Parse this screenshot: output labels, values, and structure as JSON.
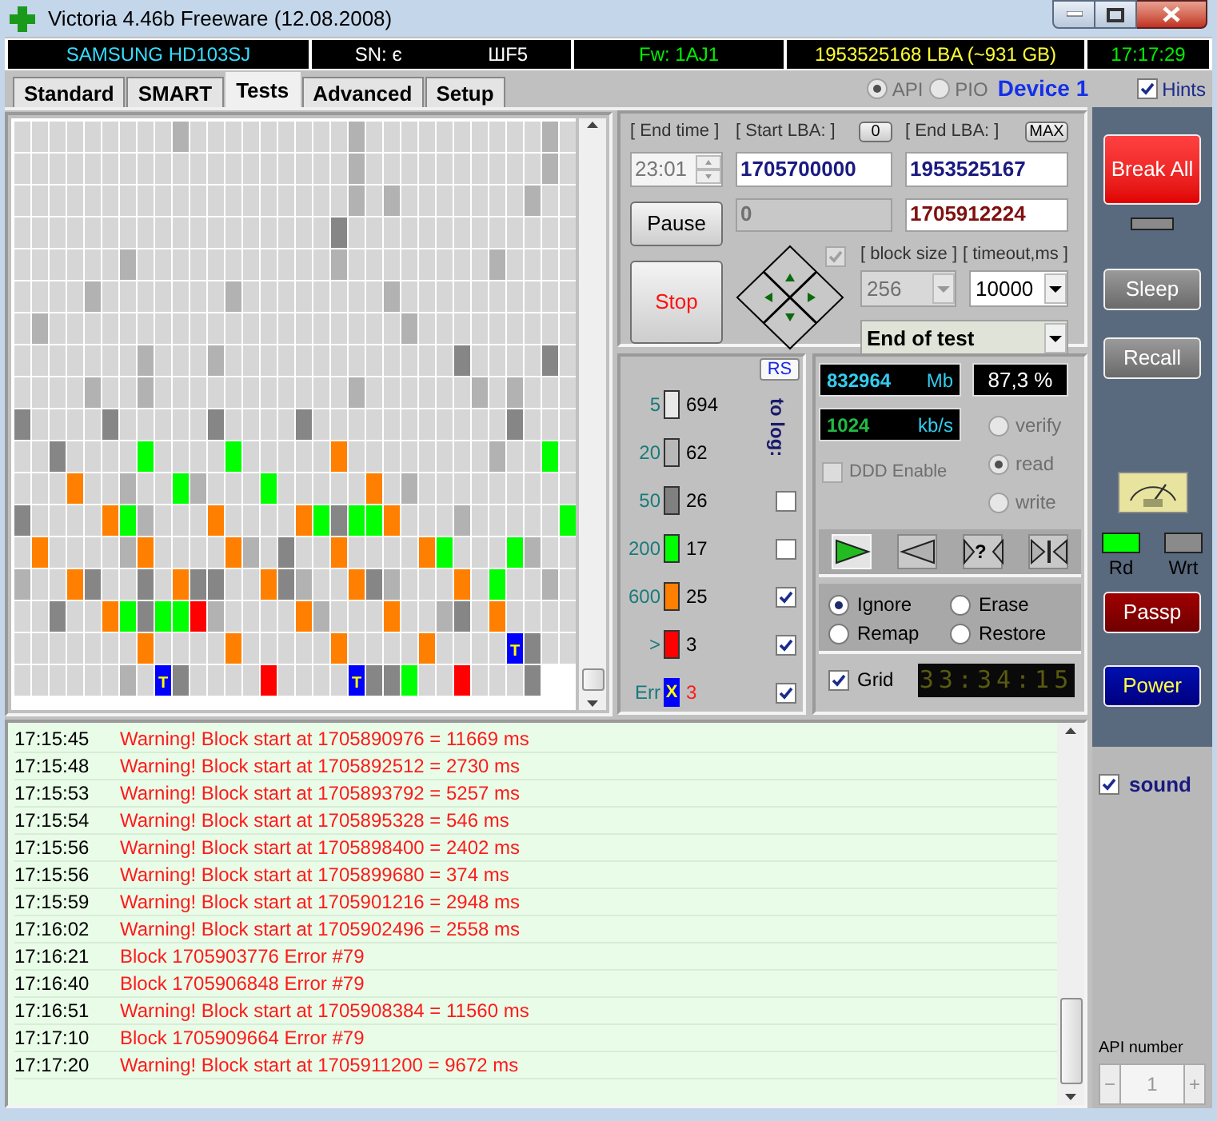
{
  "window": {
    "title": "Victoria 4.46b Freeware (12.08.2008)"
  },
  "info_bar": [
    {
      "texts": [
        "SAMSUNG HD103SJ"
      ],
      "kind": "model"
    },
    {
      "texts": [
        "SN: є",
        "ШF5"
      ],
      "kind": "serial"
    },
    {
      "texts": [
        "Fw: 1AJ1"
      ],
      "kind": "firmware"
    },
    {
      "texts": [
        "1953525168 LBA (~931 GB)"
      ],
      "kind": "capacity"
    },
    {
      "texts": [
        "17:17:29"
      ],
      "kind": "clock"
    }
  ],
  "tabs": [
    {
      "label": "Standard",
      "selected": false
    },
    {
      "label": "SMART",
      "selected": false
    },
    {
      "label": "Tests",
      "selected": true
    },
    {
      "label": "Advanced",
      "selected": false
    },
    {
      "label": "Setup",
      "selected": false
    }
  ],
  "interface": {
    "options": [
      {
        "label": "API",
        "selected": true,
        "disabled": true
      },
      {
        "label": "PIO",
        "selected": false,
        "disabled": true
      }
    ],
    "device": "Device 1"
  },
  "hints": {
    "label": "Hints",
    "checked": true
  },
  "grid": {
    "rows": [
      [
        {
          "color": "#d6d6d6"
        },
        {
          "color": "#d6d6d6"
        },
        {
          "color": "#d6d6d6"
        },
        {
          "color": "#d6d6d6"
        },
        {
          "color": "#d6d6d6"
        },
        {
          "color": "#d6d6d6"
        },
        {
          "color": "#d6d6d6"
        },
        {
          "color": "#d6d6d6"
        },
        {
          "color": "#d6d6d6"
        },
        {
          "color": "#b2b2b2"
        },
        {
          "color": "#d6d6d6"
        },
        {
          "color": "#d6d6d6"
        },
        {
          "color": "#d6d6d6"
        },
        {
          "color": "#d6d6d6"
        },
        {
          "color": "#d6d6d6"
        },
        {
          "color": "#d6d6d6"
        },
        {
          "color": "#d6d6d6"
        },
        {
          "color": "#d6d6d6"
        },
        {
          "color": "#d6d6d6"
        },
        {
          "color": "#b2b2b2"
        },
        {
          "color": "#d6d6d6"
        },
        {
          "color": "#d6d6d6"
        },
        {
          "color": "#d6d6d6"
        },
        {
          "color": "#d6d6d6"
        },
        {
          "color": "#d6d6d6"
        },
        {
          "color": "#d6d6d6"
        },
        {
          "color": "#d6d6d6"
        },
        {
          "color": "#d6d6d6"
        },
        {
          "color": "#d6d6d6"
        },
        {
          "color": "#d6d6d6"
        },
        {
          "color": "#b2b2b2"
        },
        {
          "color": "#d6d6d6"
        }
      ],
      [
        {
          "color": "#d6d6d6"
        },
        {
          "color": "#d6d6d6"
        },
        {
          "color": "#d6d6d6"
        },
        {
          "color": "#d6d6d6"
        },
        {
          "color": "#d6d6d6"
        },
        {
          "color": "#d6d6d6"
        },
        {
          "color": "#d6d6d6"
        },
        {
          "color": "#d6d6d6"
        },
        {
          "color": "#d6d6d6"
        },
        {
          "color": "#d6d6d6"
        },
        {
          "color": "#d6d6d6"
        },
        {
          "color": "#d6d6d6"
        },
        {
          "color": "#d6d6d6"
        },
        {
          "color": "#d6d6d6"
        },
        {
          "color": "#d6d6d6"
        },
        {
          "color": "#d6d6d6"
        },
        {
          "color": "#d6d6d6"
        },
        {
          "color": "#d6d6d6"
        },
        {
          "color": "#d6d6d6"
        },
        {
          "color": "#b2b2b2"
        },
        {
          "color": "#d6d6d6"
        },
        {
          "color": "#d6d6d6"
        },
        {
          "color": "#d6d6d6"
        },
        {
          "color": "#d6d6d6"
        },
        {
          "color": "#d6d6d6"
        },
        {
          "color": "#d6d6d6"
        },
        {
          "color": "#d6d6d6"
        },
        {
          "color": "#d6d6d6"
        },
        {
          "color": "#d6d6d6"
        },
        {
          "color": "#d6d6d6"
        },
        {
          "color": "#b2b2b2"
        },
        {
          "color": "#d6d6d6"
        }
      ],
      [
        {
          "color": "#d6d6d6"
        },
        {
          "color": "#d6d6d6"
        },
        {
          "color": "#d6d6d6"
        },
        {
          "color": "#d6d6d6"
        },
        {
          "color": "#d6d6d6"
        },
        {
          "color": "#d6d6d6"
        },
        {
          "color": "#d6d6d6"
        },
        {
          "color": "#d6d6d6"
        },
        {
          "color": "#d6d6d6"
        },
        {
          "color": "#d6d6d6"
        },
        {
          "color": "#d6d6d6"
        },
        {
          "color": "#d6d6d6"
        },
        {
          "color": "#d6d6d6"
        },
        {
          "color": "#d6d6d6"
        },
        {
          "color": "#d6d6d6"
        },
        {
          "color": "#d6d6d6"
        },
        {
          "color": "#d6d6d6"
        },
        {
          "color": "#d6d6d6"
        },
        {
          "color": "#d6d6d6"
        },
        {
          "color": "#b2b2b2"
        },
        {
          "color": "#d6d6d6"
        },
        {
          "color": "#b2b2b2"
        },
        {
          "color": "#d6d6d6"
        },
        {
          "color": "#d6d6d6"
        },
        {
          "color": "#d6d6d6"
        },
        {
          "color": "#d6d6d6"
        },
        {
          "color": "#d6d6d6"
        },
        {
          "color": "#d6d6d6"
        },
        {
          "color": "#d6d6d6"
        },
        {
          "color": "#b2b2b2"
        },
        {
          "color": "#d6d6d6"
        },
        {
          "color": "#d6d6d6"
        }
      ],
      [
        {
          "color": "#d6d6d6"
        },
        {
          "color": "#d6d6d6"
        },
        {
          "color": "#d6d6d6"
        },
        {
          "color": "#d6d6d6"
        },
        {
          "color": "#d6d6d6"
        },
        {
          "color": "#d6d6d6"
        },
        {
          "color": "#d6d6d6"
        },
        {
          "color": "#d6d6d6"
        },
        {
          "color": "#d6d6d6"
        },
        {
          "color": "#d6d6d6"
        },
        {
          "color": "#d6d6d6"
        },
        {
          "color": "#d6d6d6"
        },
        {
          "color": "#d6d6d6"
        },
        {
          "color": "#d6d6d6"
        },
        {
          "color": "#d6d6d6"
        },
        {
          "color": "#d6d6d6"
        },
        {
          "color": "#d6d6d6"
        },
        {
          "color": "#d6d6d6"
        },
        {
          "color": "#868686"
        },
        {
          "color": "#d6d6d6"
        },
        {
          "color": "#d6d6d6"
        },
        {
          "color": "#d6d6d6"
        },
        {
          "color": "#d6d6d6"
        },
        {
          "color": "#d6d6d6"
        },
        {
          "color": "#d6d6d6"
        },
        {
          "color": "#d6d6d6"
        },
        {
          "color": "#d6d6d6"
        },
        {
          "color": "#d6d6d6"
        },
        {
          "color": "#d6d6d6"
        },
        {
          "color": "#d6d6d6"
        },
        {
          "color": "#d6d6d6"
        },
        {
          "color": "#d6d6d6"
        }
      ],
      [
        {
          "color": "#d6d6d6"
        },
        {
          "color": "#d6d6d6"
        },
        {
          "color": "#d6d6d6"
        },
        {
          "color": "#d6d6d6"
        },
        {
          "color": "#d6d6d6"
        },
        {
          "color": "#d6d6d6"
        },
        {
          "color": "#b2b2b2"
        },
        {
          "color": "#d6d6d6"
        },
        {
          "color": "#d6d6d6"
        },
        {
          "color": "#d6d6d6"
        },
        {
          "color": "#d6d6d6"
        },
        {
          "color": "#d6d6d6"
        },
        {
          "color": "#d6d6d6"
        },
        {
          "color": "#d6d6d6"
        },
        {
          "color": "#d6d6d6"
        },
        {
          "color": "#d6d6d6"
        },
        {
          "color": "#d6d6d6"
        },
        {
          "color": "#d6d6d6"
        },
        {
          "color": "#b2b2b2"
        },
        {
          "color": "#d6d6d6"
        },
        {
          "color": "#d6d6d6"
        },
        {
          "color": "#d6d6d6"
        },
        {
          "color": "#d6d6d6"
        },
        {
          "color": "#d6d6d6"
        },
        {
          "color": "#d6d6d6"
        },
        {
          "color": "#d6d6d6"
        },
        {
          "color": "#d6d6d6"
        },
        {
          "color": "#b2b2b2"
        },
        {
          "color": "#d6d6d6"
        },
        {
          "color": "#d6d6d6"
        },
        {
          "color": "#d6d6d6"
        },
        {
          "color": "#d6d6d6"
        }
      ],
      [
        {
          "color": "#d6d6d6"
        },
        {
          "color": "#d6d6d6"
        },
        {
          "color": "#d6d6d6"
        },
        {
          "color": "#d6d6d6"
        },
        {
          "color": "#b2b2b2"
        },
        {
          "color": "#d6d6d6"
        },
        {
          "color": "#d6d6d6"
        },
        {
          "color": "#d6d6d6"
        },
        {
          "color": "#d6d6d6"
        },
        {
          "color": "#d6d6d6"
        },
        {
          "color": "#d6d6d6"
        },
        {
          "color": "#d6d6d6"
        },
        {
          "color": "#b2b2b2"
        },
        {
          "color": "#d6d6d6"
        },
        {
          "color": "#d6d6d6"
        },
        {
          "color": "#d6d6d6"
        },
        {
          "color": "#d6d6d6"
        },
        {
          "color": "#d6d6d6"
        },
        {
          "color": "#d6d6d6"
        },
        {
          "color": "#d6d6d6"
        },
        {
          "color": "#d6d6d6"
        },
        {
          "color": "#b2b2b2"
        },
        {
          "color": "#d6d6d6"
        },
        {
          "color": "#d6d6d6"
        },
        {
          "color": "#d6d6d6"
        },
        {
          "color": "#d6d6d6"
        },
        {
          "color": "#d6d6d6"
        },
        {
          "color": "#d6d6d6"
        },
        {
          "color": "#d6d6d6"
        },
        {
          "color": "#d6d6d6"
        },
        {
          "color": "#d6d6d6"
        },
        {
          "color": "#d6d6d6"
        }
      ],
      [
        {
          "color": "#d6d6d6"
        },
        {
          "color": "#b2b2b2"
        },
        {
          "color": "#d6d6d6"
        },
        {
          "color": "#d6d6d6"
        },
        {
          "color": "#d6d6d6"
        },
        {
          "color": "#d6d6d6"
        },
        {
          "color": "#d6d6d6"
        },
        {
          "color": "#d6d6d6"
        },
        {
          "color": "#d6d6d6"
        },
        {
          "color": "#d6d6d6"
        },
        {
          "color": "#d6d6d6"
        },
        {
          "color": "#d6d6d6"
        },
        {
          "color": "#d6d6d6"
        },
        {
          "color": "#d6d6d6"
        },
        {
          "color": "#d6d6d6"
        },
        {
          "color": "#d6d6d6"
        },
        {
          "color": "#d6d6d6"
        },
        {
          "color": "#d6d6d6"
        },
        {
          "color": "#d6d6d6"
        },
        {
          "color": "#d6d6d6"
        },
        {
          "color": "#d6d6d6"
        },
        {
          "color": "#d6d6d6"
        },
        {
          "color": "#b2b2b2"
        },
        {
          "color": "#d6d6d6"
        },
        {
          "color": "#d6d6d6"
        },
        {
          "color": "#d6d6d6"
        },
        {
          "color": "#d6d6d6"
        },
        {
          "color": "#d6d6d6"
        },
        {
          "color": "#d6d6d6"
        },
        {
          "color": "#d6d6d6"
        },
        {
          "color": "#d6d6d6"
        },
        {
          "color": "#d6d6d6"
        }
      ],
      [
        {
          "color": "#d6d6d6"
        },
        {
          "color": "#d6d6d6"
        },
        {
          "color": "#d6d6d6"
        },
        {
          "color": "#d6d6d6"
        },
        {
          "color": "#d6d6d6"
        },
        {
          "color": "#d6d6d6"
        },
        {
          "color": "#d6d6d6"
        },
        {
          "color": "#b2b2b2"
        },
        {
          "color": "#d6d6d6"
        },
        {
          "color": "#d6d6d6"
        },
        {
          "color": "#d6d6d6"
        },
        {
          "color": "#b2b2b2"
        },
        {
          "color": "#d6d6d6"
        },
        {
          "color": "#d6d6d6"
        },
        {
          "color": "#d6d6d6"
        },
        {
          "color": "#d6d6d6"
        },
        {
          "color": "#d6d6d6"
        },
        {
          "color": "#d6d6d6"
        },
        {
          "color": "#d6d6d6"
        },
        {
          "color": "#d6d6d6"
        },
        {
          "color": "#d6d6d6"
        },
        {
          "color": "#d6d6d6"
        },
        {
          "color": "#d6d6d6"
        },
        {
          "color": "#d6d6d6"
        },
        {
          "color": "#d6d6d6"
        },
        {
          "color": "#868686"
        },
        {
          "color": "#d6d6d6"
        },
        {
          "color": "#d6d6d6"
        },
        {
          "color": "#d6d6d6"
        },
        {
          "color": "#d6d6d6"
        },
        {
          "color": "#868686"
        },
        {
          "color": "#d6d6d6"
        }
      ],
      [
        {
          "color": "#d6d6d6"
        },
        {
          "color": "#d6d6d6"
        },
        {
          "color": "#d6d6d6"
        },
        {
          "color": "#d6d6d6"
        },
        {
          "color": "#b2b2b2"
        },
        {
          "color": "#d6d6d6"
        },
        {
          "color": "#d6d6d6"
        },
        {
          "color": "#b2b2b2"
        },
        {
          "color": "#d6d6d6"
        },
        {
          "color": "#d6d6d6"
        },
        {
          "color": "#d6d6d6"
        },
        {
          "color": "#d6d6d6"
        },
        {
          "color": "#d6d6d6"
        },
        {
          "color": "#d6d6d6"
        },
        {
          "color": "#d6d6d6"
        },
        {
          "color": "#d6d6d6"
        },
        {
          "color": "#d6d6d6"
        },
        {
          "color": "#d6d6d6"
        },
        {
          "color": "#d6d6d6"
        },
        {
          "color": "#b2b2b2"
        },
        {
          "color": "#d6d6d6"
        },
        {
          "color": "#d6d6d6"
        },
        {
          "color": "#d6d6d6"
        },
        {
          "color": "#d6d6d6"
        },
        {
          "color": "#d6d6d6"
        },
        {
          "color": "#d6d6d6"
        },
        {
          "color": "#b2b2b2"
        },
        {
          "color": "#d6d6d6"
        },
        {
          "color": "#b2b2b2"
        },
        {
          "color": "#d6d6d6"
        },
        {
          "color": "#d6d6d6"
        },
        {
          "color": "#d6d6d6"
        }
      ],
      [
        {
          "color": "#868686"
        },
        {
          "color": "#d6d6d6"
        },
        {
          "color": "#d6d6d6"
        },
        {
          "color": "#d6d6d6"
        },
        {
          "color": "#d6d6d6"
        },
        {
          "color": "#868686"
        },
        {
          "color": "#d6d6d6"
        },
        {
          "color": "#d6d6d6"
        },
        {
          "color": "#d6d6d6"
        },
        {
          "color": "#d6d6d6"
        },
        {
          "color": "#d6d6d6"
        },
        {
          "color": "#868686"
        },
        {
          "color": "#d6d6d6"
        },
        {
          "color": "#d6d6d6"
        },
        {
          "color": "#d6d6d6"
        },
        {
          "color": "#d6d6d6"
        },
        {
          "color": "#868686"
        },
        {
          "color": "#d6d6d6"
        },
        {
          "color": "#d6d6d6"
        },
        {
          "color": "#d6d6d6"
        },
        {
          "color": "#d6d6d6"
        },
        {
          "color": "#d6d6d6"
        },
        {
          "color": "#d6d6d6"
        },
        {
          "color": "#d6d6d6"
        },
        {
          "color": "#d6d6d6"
        },
        {
          "color": "#d6d6d6"
        },
        {
          "color": "#d6d6d6"
        },
        {
          "color": "#d6d6d6"
        },
        {
          "color": "#868686"
        },
        {
          "color": "#d6d6d6"
        },
        {
          "color": "#d6d6d6"
        },
        {
          "color": "#d6d6d6"
        }
      ],
      [
        {
          "color": "#d6d6d6"
        },
        {
          "color": "#d6d6d6"
        },
        {
          "color": "#868686"
        },
        {
          "color": "#d6d6d6"
        },
        {
          "color": "#d6d6d6"
        },
        {
          "color": "#d6d6d6"
        },
        {
          "color": "#d6d6d6"
        },
        {
          "color": "#00ff00"
        },
        {
          "color": "#d6d6d6"
        },
        {
          "color": "#d6d6d6"
        },
        {
          "color": "#d6d6d6"
        },
        {
          "color": "#d6d6d6"
        },
        {
          "color": "#00ff00"
        },
        {
          "color": "#d6d6d6"
        },
        {
          "color": "#d6d6d6"
        },
        {
          "color": "#d6d6d6"
        },
        {
          "color": "#d6d6d6"
        },
        {
          "color": "#d6d6d6"
        },
        {
          "color": "#ff8000"
        },
        {
          "color": "#d6d6d6"
        },
        {
          "color": "#d6d6d6"
        },
        {
          "color": "#d6d6d6"
        },
        {
          "color": "#d6d6d6"
        },
        {
          "color": "#d6d6d6"
        },
        {
          "color": "#d6d6d6"
        },
        {
          "color": "#d6d6d6"
        },
        {
          "color": "#d6d6d6"
        },
        {
          "color": "#b2b2b2"
        },
        {
          "color": "#d6d6d6"
        },
        {
          "color": "#d6d6d6"
        },
        {
          "color": "#00ff00"
        },
        {
          "color": "#d6d6d6"
        }
      ],
      [
        {
          "color": "#d6d6d6"
        },
        {
          "color": "#d6d6d6"
        },
        {
          "color": "#d6d6d6"
        },
        {
          "color": "#ff8000"
        },
        {
          "color": "#d6d6d6"
        },
        {
          "color": "#d6d6d6"
        },
        {
          "color": "#b2b2b2"
        },
        {
          "color": "#d6d6d6"
        },
        {
          "color": "#d6d6d6"
        },
        {
          "color": "#00ff00"
        },
        {
          "color": "#b2b2b2"
        },
        {
          "color": "#d6d6d6"
        },
        {
          "color": "#d6d6d6"
        },
        {
          "color": "#d6d6d6"
        },
        {
          "color": "#00ff00"
        },
        {
          "color": "#d6d6d6"
        },
        {
          "color": "#d6d6d6"
        },
        {
          "color": "#d6d6d6"
        },
        {
          "color": "#d6d6d6"
        },
        {
          "color": "#d6d6d6"
        },
        {
          "color": "#ff8000"
        },
        {
          "color": "#d6d6d6"
        },
        {
          "color": "#b2b2b2"
        },
        {
          "color": "#d6d6d6"
        },
        {
          "color": "#d6d6d6"
        },
        {
          "color": "#d6d6d6"
        },
        {
          "color": "#d6d6d6"
        },
        {
          "color": "#d6d6d6"
        },
        {
          "color": "#d6d6d6"
        },
        {
          "color": "#d6d6d6"
        },
        {
          "color": "#d6d6d6"
        },
        {
          "color": "#d6d6d6"
        }
      ],
      [
        {
          "color": "#868686"
        },
        {
          "color": "#d6d6d6"
        },
        {
          "color": "#d6d6d6"
        },
        {
          "color": "#d6d6d6"
        },
        {
          "color": "#d6d6d6"
        },
        {
          "color": "#ff8000"
        },
        {
          "color": "#00ff00"
        },
        {
          "color": "#b2b2b2"
        },
        {
          "color": "#d6d6d6"
        },
        {
          "color": "#d6d6d6"
        },
        {
          "color": "#d6d6d6"
        },
        {
          "color": "#ff8000"
        },
        {
          "color": "#d6d6d6"
        },
        {
          "color": "#d6d6d6"
        },
        {
          "color": "#d6d6d6"
        },
        {
          "color": "#d6d6d6"
        },
        {
          "color": "#ff8000"
        },
        {
          "color": "#00ff00"
        },
        {
          "color": "#868686"
        },
        {
          "color": "#00ff00"
        },
        {
          "color": "#00ff00"
        },
        {
          "color": "#ff8000"
        },
        {
          "color": "#d6d6d6"
        },
        {
          "color": "#d6d6d6"
        },
        {
          "color": "#d6d6d6"
        },
        {
          "color": "#b2b2b2"
        },
        {
          "color": "#d6d6d6"
        },
        {
          "color": "#d6d6d6"
        },
        {
          "color": "#d6d6d6"
        },
        {
          "color": "#d6d6d6"
        },
        {
          "color": "#d6d6d6"
        },
        {
          "color": "#00ff00"
        }
      ],
      [
        {
          "color": "#d6d6d6"
        },
        {
          "color": "#ff8000"
        },
        {
          "color": "#d6d6d6"
        },
        {
          "color": "#d6d6d6"
        },
        {
          "color": "#d6d6d6"
        },
        {
          "color": "#d6d6d6"
        },
        {
          "color": "#b2b2b2"
        },
        {
          "color": "#ff8000"
        },
        {
          "color": "#d6d6d6"
        },
        {
          "color": "#d6d6d6"
        },
        {
          "color": "#d6d6d6"
        },
        {
          "color": "#d6d6d6"
        },
        {
          "color": "#ff8000"
        },
        {
          "color": "#b2b2b2"
        },
        {
          "color": "#d6d6d6"
        },
        {
          "color": "#868686"
        },
        {
          "color": "#d6d6d6"
        },
        {
          "color": "#d6d6d6"
        },
        {
          "color": "#ff8000"
        },
        {
          "color": "#d6d6d6"
        },
        {
          "color": "#d6d6d6"
        },
        {
          "color": "#d6d6d6"
        },
        {
          "color": "#d6d6d6"
        },
        {
          "color": "#ff8000"
        },
        {
          "color": "#00ff00"
        },
        {
          "color": "#d6d6d6"
        },
        {
          "color": "#d6d6d6"
        },
        {
          "color": "#d6d6d6"
        },
        {
          "color": "#00ff00"
        },
        {
          "color": "#b2b2b2"
        },
        {
          "color": "#d6d6d6"
        },
        {
          "color": "#d6d6d6"
        }
      ],
      [
        {
          "color": "#b2b2b2"
        },
        {
          "color": "#d6d6d6"
        },
        {
          "color": "#d6d6d6"
        },
        {
          "color": "#ff8000"
        },
        {
          "color": "#868686"
        },
        {
          "color": "#d6d6d6"
        },
        {
          "color": "#d6d6d6"
        },
        {
          "color": "#868686"
        },
        {
          "color": "#d6d6d6"
        },
        {
          "color": "#ff8000"
        },
        {
          "color": "#868686"
        },
        {
          "color": "#868686"
        },
        {
          "color": "#d6d6d6"
        },
        {
          "color": "#d6d6d6"
        },
        {
          "color": "#ff8000"
        },
        {
          "color": "#868686"
        },
        {
          "color": "#b2b2b2"
        },
        {
          "color": "#d6d6d6"
        },
        {
          "color": "#d6d6d6"
        },
        {
          "color": "#ff8000"
        },
        {
          "color": "#868686"
        },
        {
          "color": "#b2b2b2"
        },
        {
          "color": "#d6d6d6"
        },
        {
          "color": "#d6d6d6"
        },
        {
          "color": "#d6d6d6"
        },
        {
          "color": "#ff8000"
        },
        {
          "color": "#d6d6d6"
        },
        {
          "color": "#00ff00"
        },
        {
          "color": "#d6d6d6"
        },
        {
          "color": "#d6d6d6"
        },
        {
          "color": "#b2b2b2"
        },
        {
          "color": "#d6d6d6"
        }
      ],
      [
        {
          "color": "#d6d6d6"
        },
        {
          "color": "#d6d6d6"
        },
        {
          "color": "#868686"
        },
        {
          "color": "#d6d6d6"
        },
        {
          "color": "#d6d6d6"
        },
        {
          "color": "#ff8000"
        },
        {
          "color": "#00ff00"
        },
        {
          "color": "#868686"
        },
        {
          "color": "#00ff00"
        },
        {
          "color": "#00ff00"
        },
        {
          "color": "#ff0000"
        },
        {
          "color": "#b2b2b2"
        },
        {
          "color": "#d6d6d6"
        },
        {
          "color": "#d6d6d6"
        },
        {
          "color": "#d6d6d6"
        },
        {
          "color": "#d6d6d6"
        },
        {
          "color": "#ff8000"
        },
        {
          "color": "#b2b2b2"
        },
        {
          "color": "#d6d6d6"
        },
        {
          "color": "#d6d6d6"
        },
        {
          "color": "#d6d6d6"
        },
        {
          "color": "#ff8000"
        },
        {
          "color": "#d6d6d6"
        },
        {
          "color": "#d6d6d6"
        },
        {
          "color": "#b2b2b2"
        },
        {
          "color": "#868686"
        },
        {
          "color": "#d6d6d6"
        },
        {
          "color": "#ff8000"
        },
        {
          "color": "#d6d6d6"
        },
        {
          "color": "#d6d6d6"
        },
        {
          "color": "#d6d6d6"
        },
        {
          "color": "#d6d6d6"
        }
      ],
      [
        {
          "color": "#d6d6d6"
        },
        {
          "color": "#d6d6d6"
        },
        {
          "color": "#d6d6d6"
        },
        {
          "color": "#d6d6d6"
        },
        {
          "color": "#d6d6d6"
        },
        {
          "color": "#d6d6d6"
        },
        {
          "color": "#d6d6d6"
        },
        {
          "color": "#ff8000"
        },
        {
          "color": "#d6d6d6"
        },
        {
          "color": "#d6d6d6"
        },
        {
          "color": "#d6d6d6"
        },
        {
          "color": "#d6d6d6"
        },
        {
          "color": "#ff8000"
        },
        {
          "color": "#d6d6d6"
        },
        {
          "color": "#d6d6d6"
        },
        {
          "color": "#d6d6d6"
        },
        {
          "color": "#d6d6d6"
        },
        {
          "color": "#d6d6d6"
        },
        {
          "color": "#ff8000"
        },
        {
          "color": "#d6d6d6"
        },
        {
          "color": "#d6d6d6"
        },
        {
          "color": "#d6d6d6"
        },
        {
          "color": "#d6d6d6"
        },
        {
          "color": "#ff8000"
        },
        {
          "color": "#d6d6d6"
        },
        {
          "color": "#d6d6d6"
        },
        {
          "color": "#d6d6d6"
        },
        {
          "color": "#d6d6d6"
        },
        {
          "color": "#0000ff",
          "label": "T"
        },
        {
          "color": "#868686"
        },
        {
          "color": "#d6d6d6"
        },
        {
          "color": "#d6d6d6"
        }
      ],
      [
        {
          "color": "#d6d6d6"
        },
        {
          "color": "#d6d6d6"
        },
        {
          "color": "#d6d6d6"
        },
        {
          "color": "#d6d6d6"
        },
        {
          "color": "#d6d6d6"
        },
        {
          "color": "#d6d6d6"
        },
        {
          "color": "#b2b2b2"
        },
        {
          "color": "#d6d6d6"
        },
        {
          "color": "#0000ff",
          "label": "T"
        },
        {
          "color": "#868686"
        },
        {
          "color": "#d6d6d6"
        },
        {
          "color": "#d6d6d6"
        },
        {
          "color": "#d6d6d6"
        },
        {
          "color": "#d6d6d6"
        },
        {
          "color": "#ff0000"
        },
        {
          "color": "#d6d6d6"
        },
        {
          "color": "#d6d6d6"
        },
        {
          "color": "#d6d6d6"
        },
        {
          "color": "#d6d6d6"
        },
        {
          "color": "#0000ff",
          "label": "T"
        },
        {
          "color": "#868686"
        },
        {
          "color": "#868686"
        },
        {
          "color": "#00ff00"
        },
        {
          "color": "#d6d6d6"
        },
        {
          "color": "#d6d6d6"
        },
        {
          "color": "#ff0000"
        },
        {
          "color": "#d6d6d6"
        },
        {
          "color": "#d6d6d6"
        },
        {
          "color": "#d6d6d6"
        },
        {
          "color": "#868686"
        }
      ]
    ]
  },
  "test_params": {
    "end_time": {
      "label": "[ End time ]",
      "value": "23:01"
    },
    "start_lba": {
      "label": "[ Start LBA: ]",
      "reset": "0",
      "value": "1705700000"
    },
    "end_lba": {
      "label": "[ End LBA: ]",
      "max": "MAX",
      "value": "1953525167"
    },
    "position": {
      "value": "0",
      "lba": "1705912224"
    },
    "pause": "Pause",
    "stop": "Stop",
    "pad_checkbox": {
      "checked": true,
      "disabled": true
    },
    "block_size": {
      "label": "[ block size ]",
      "value": "256",
      "disabled": true
    },
    "timeout": {
      "label": "[ timeout,ms ]",
      "value": "10000"
    },
    "end_action": "End of test"
  },
  "legend": {
    "rs": "RS",
    "to_log": "to log:",
    "items": [
      {
        "kind": "block",
        "threshold": "5",
        "count": "694",
        "color": "#e8e8e8"
      },
      {
        "kind": "block",
        "threshold": "20",
        "count": "62",
        "color": "#b8b8b8"
      },
      {
        "kind": "block",
        "threshold": "50",
        "count": "26",
        "color": "#808080",
        "log": false
      },
      {
        "kind": "block",
        "threshold": "200",
        "count": "17",
        "color": "#00ff00",
        "log": false
      },
      {
        "kind": "block",
        "threshold": "600",
        "count": "25",
        "color": "#ff8000",
        "log": true
      },
      {
        "kind": "block",
        "threshold": ">",
        "count": "3",
        "color": "#ff0000",
        "log": true
      },
      {
        "kind": "error",
        "threshold": "Err",
        "count": "3",
        "color": "#0000ff",
        "mark": "X",
        "log": true
      }
    ]
  },
  "stats": {
    "mb": "832964",
    "mb_unit": "Mb",
    "percent": "87,3 %",
    "speed": "1024",
    "speed_unit": "kb/s",
    "ddd": {
      "label": "DDD Enable",
      "checked": false,
      "disabled": true
    },
    "modes": [
      {
        "label": "verify",
        "selected": false
      },
      {
        "label": "read",
        "selected": true
      },
      {
        "label": "write",
        "selected": false
      }
    ]
  },
  "scan_buttons": [
    {
      "kind": "forward",
      "selected": true
    },
    {
      "kind": "backward",
      "selected": false
    },
    {
      "kind": "random",
      "label": "?",
      "selected": false
    },
    {
      "kind": "edges",
      "selected": false
    }
  ],
  "repair": [
    {
      "label": "Ignore",
      "selected": true
    },
    {
      "label": "Erase",
      "selected": false
    },
    {
      "label": "Remap",
      "selected": false
    },
    {
      "label": "Restore",
      "selected": false
    }
  ],
  "grid_toggle": {
    "label": "Grid",
    "checked": true
  },
  "elapsed": "33:34:15",
  "sidebar": {
    "break_all": "Break All",
    "sleep": "Sleep",
    "recall": "Recall",
    "rd": {
      "label": "Rd",
      "on": true
    },
    "wrt": {
      "label": "Wrt",
      "on": false
    },
    "passp": "Passp",
    "power": "Power",
    "sound": {
      "label": "sound",
      "checked": true
    },
    "api_number": {
      "label": "API number",
      "value": "1",
      "minus": "−",
      "plus": "+"
    }
  },
  "log": [
    {
      "time": "17:15:45",
      "message": "Warning! Block start at 1705890976 = 11669 ms"
    },
    {
      "time": "17:15:48",
      "message": "Warning! Block start at 1705892512 = 2730 ms"
    },
    {
      "time": "17:15:53",
      "message": "Warning! Block start at 1705893792 = 5257 ms"
    },
    {
      "time": "17:15:54",
      "message": "Warning! Block start at 1705895328 = 546 ms"
    },
    {
      "time": "17:15:56",
      "message": "Warning! Block start at 1705898400 = 2402 ms"
    },
    {
      "time": "17:15:56",
      "message": "Warning! Block start at 1705899680 = 374 ms"
    },
    {
      "time": "17:15:59",
      "message": "Warning! Block start at 1705901216 = 2948 ms"
    },
    {
      "time": "17:16:02",
      "message": "Warning! Block start at 1705902496 = 2558 ms"
    },
    {
      "time": "17:16:21",
      "message": "Block 1705903776 Error #79"
    },
    {
      "time": "17:16:40",
      "message": "Block 1705906848 Error #79"
    },
    {
      "time": "17:16:51",
      "message": "Warning! Block start at 1705908384 = 11560 ms"
    },
    {
      "time": "17:17:10",
      "message": "Block 1705909664 Error #79"
    },
    {
      "time": "17:17:20",
      "message": "Warning! Block start at 1705911200 = 9672 ms"
    }
  ]
}
